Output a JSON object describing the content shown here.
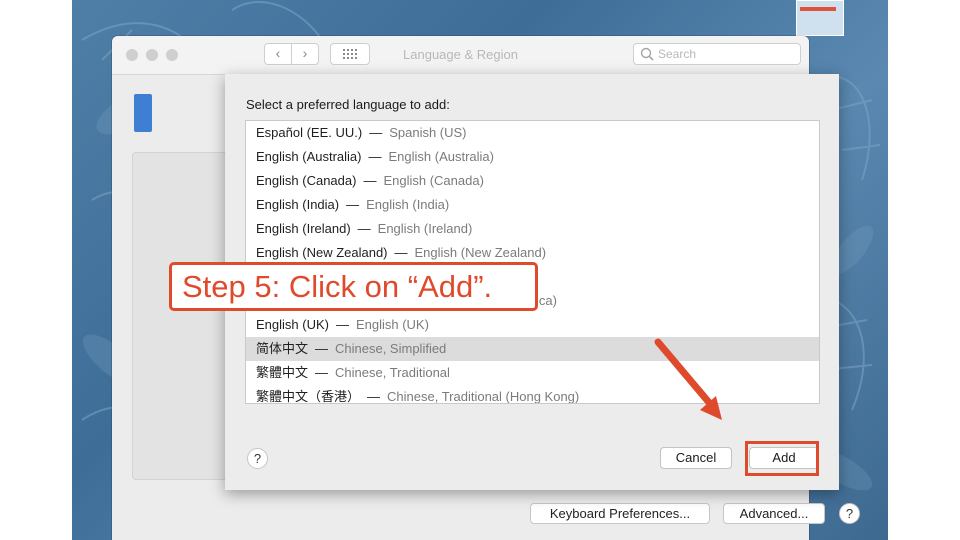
{
  "window": {
    "title": "Language & Region",
    "search_placeholder": "Search"
  },
  "sheet": {
    "prompt": "Select a preferred language to add:",
    "languages": [
      {
        "native": "Español (EE. UU.)",
        "english": "Spanish (US)",
        "selected": false
      },
      {
        "native": "English (Australia)",
        "english": "English (Australia)",
        "selected": false
      },
      {
        "native": "English (Canada)",
        "english": "English (Canada)",
        "selected": false
      },
      {
        "native": "English (India)",
        "english": "English (India)",
        "selected": false
      },
      {
        "native": "English (Ireland)",
        "english": "English (Ireland)",
        "selected": false
      },
      {
        "native": "English (New Zealand)",
        "english": "English (New Zealand)",
        "selected": false
      },
      {
        "native": "",
        "english": "",
        "selected": false
      },
      {
        "native": "",
        "english": "ica)",
        "selected": false
      },
      {
        "native": "English (UK)",
        "english": "English (UK)",
        "selected": false
      },
      {
        "native": "简体中文",
        "english": "Chinese, Simplified",
        "selected": true
      },
      {
        "native": "繁體中文",
        "english": "Chinese, Traditional",
        "selected": false
      },
      {
        "native": "繁體中文（香港）",
        "english": "Chinese, Traditional (Hong Kong)",
        "selected": false
      }
    ],
    "separator": "—",
    "help_label": "?",
    "cancel_label": "Cancel",
    "add_label": "Add"
  },
  "bottom_buttons": {
    "keyboard_label": "Keyboard Preferences...",
    "advanced_label": "Advanced...",
    "help_label": "?"
  },
  "annotation": {
    "callout_text": "Step 5: Click on “Add”.",
    "color": "#e04a2c"
  }
}
